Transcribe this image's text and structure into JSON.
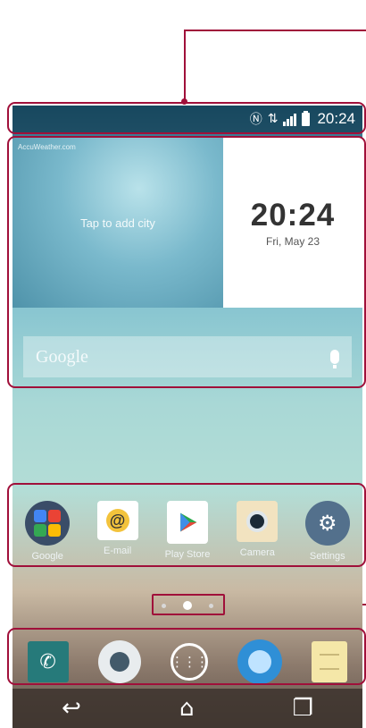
{
  "status_bar": {
    "time": "20:24",
    "nfc_icon": "nfc-icon",
    "network_icon": "lte-icon",
    "signal_icon": "signal-icon",
    "battery_icon": "battery-icon"
  },
  "weather_widget": {
    "source": "AccuWeather.com",
    "prompt": "Tap to add city"
  },
  "clock_widget": {
    "time": "20:24",
    "date": "Fri, May 23"
  },
  "search_bar": {
    "label": "Google",
    "mic_icon": "mic-icon"
  },
  "apps": [
    {
      "label": "Google",
      "icon": "google-folder-icon"
    },
    {
      "label": "E-mail",
      "icon": "email-icon"
    },
    {
      "label": "Play Store",
      "icon": "play-store-icon"
    },
    {
      "label": "Camera",
      "icon": "camera-icon"
    },
    {
      "label": "Settings",
      "icon": "settings-icon"
    }
  ],
  "pager": {
    "pages": 3,
    "active_page": 2
  },
  "dock": [
    {
      "icon": "phone-icon"
    },
    {
      "icon": "contacts-icon"
    },
    {
      "icon": "apps-icon"
    },
    {
      "icon": "browser-icon"
    },
    {
      "icon": "memo-icon"
    }
  ],
  "nav_bar": {
    "back": "back-icon",
    "home": "home-icon",
    "recent": "recent-apps-icon"
  },
  "colors": {
    "annotation": "#a0103a",
    "status_bar_bg": "#0a283c"
  }
}
